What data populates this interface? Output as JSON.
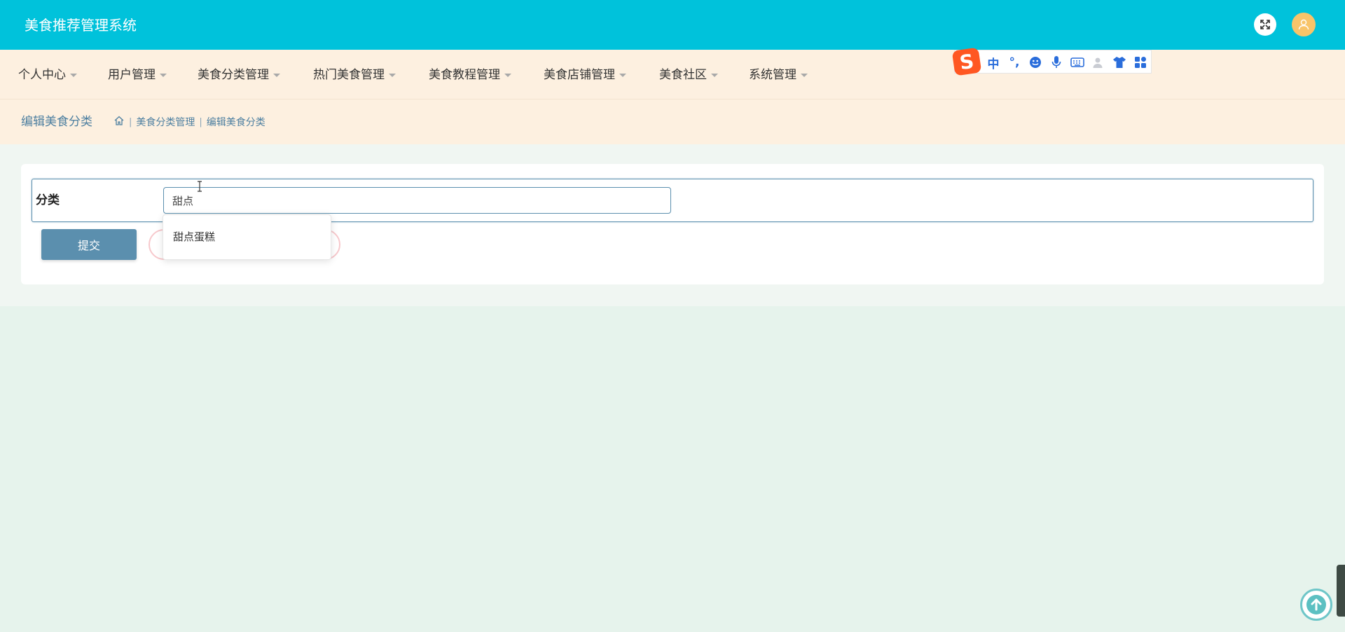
{
  "header": {
    "app_title": "美食推荐管理系统",
    "fullscreen_icon": "expand-icon",
    "avatar_icon": "user-avatar-icon"
  },
  "nav": {
    "items": [
      {
        "label": "个人中心"
      },
      {
        "label": "用户管理"
      },
      {
        "label": "美食分类管理"
      },
      {
        "label": "热门美食管理"
      },
      {
        "label": "美食教程管理"
      },
      {
        "label": "美食店铺管理"
      },
      {
        "label": "美食社区"
      },
      {
        "label": "系统管理"
      }
    ]
  },
  "ime": {
    "logo": "S",
    "mode_label": "中",
    "punct_label": "°,"
  },
  "breadcrumb": {
    "page_title": "编辑美食分类",
    "home_icon": "home-icon",
    "items": [
      "美食分类管理",
      "编辑美食分类"
    ],
    "separator": "|"
  },
  "form": {
    "category_label": "分类",
    "category_value": "甜点",
    "suggestion": "甜点蛋糕",
    "submit_label": "提交"
  },
  "colors": {
    "header_bg": "#00c2db",
    "nav_bg": "#fdf0e0",
    "accent": "#5b8fae",
    "page_bg": "#e6f3ec"
  }
}
